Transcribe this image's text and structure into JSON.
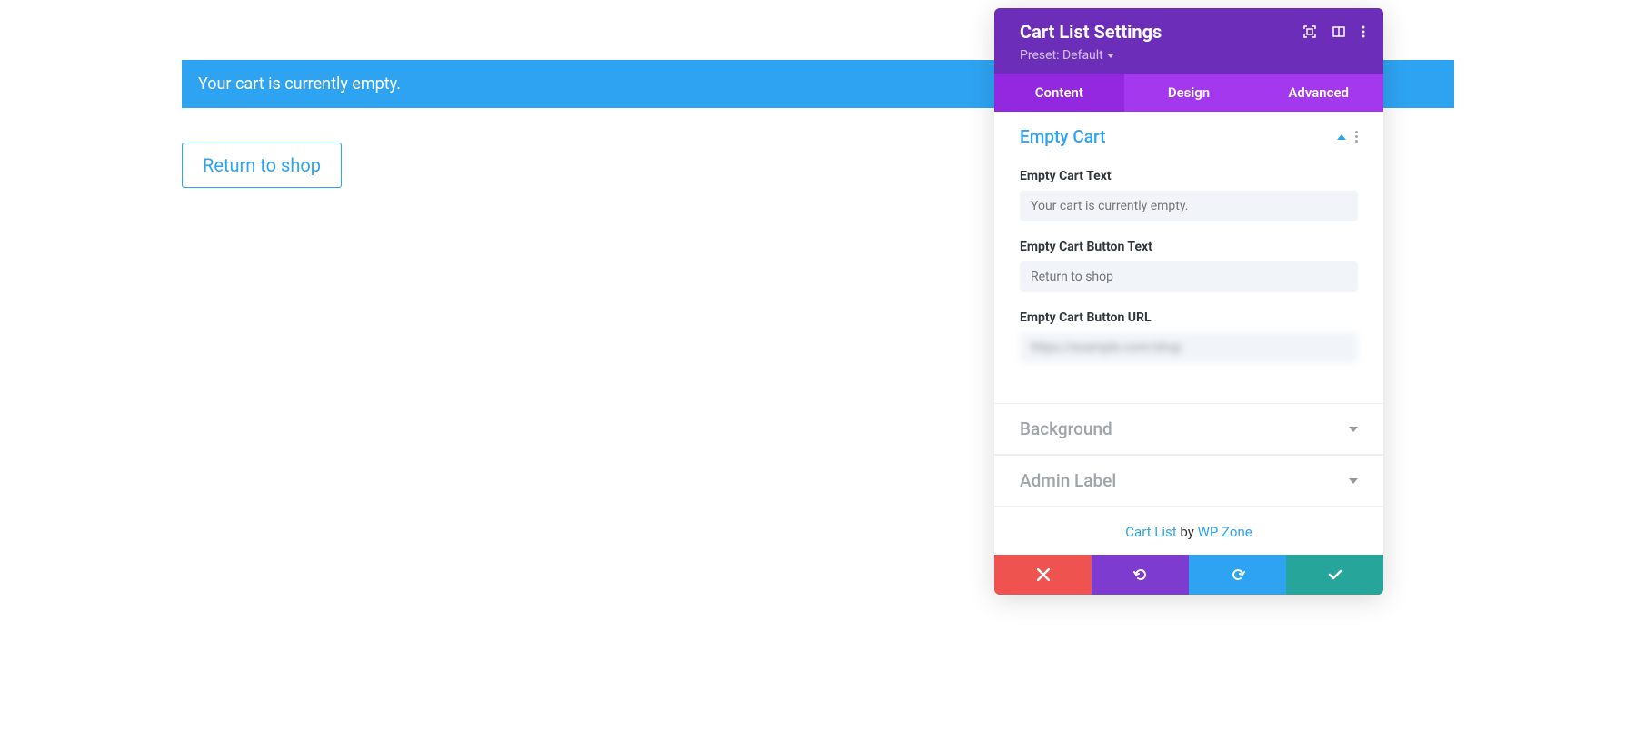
{
  "main": {
    "notice_text": "Your cart is currently empty.",
    "return_button_label": "Return to shop"
  },
  "panel": {
    "title": "Cart List Settings",
    "preset_label": "Preset: Default",
    "tabs": {
      "content": "Content",
      "design": "Design",
      "advanced": "Advanced"
    },
    "sections": {
      "empty_cart": {
        "title": "Empty Cart",
        "fields": {
          "text": {
            "label": "Empty Cart Text",
            "placeholder": "Your cart is currently empty."
          },
          "button_text": {
            "label": "Empty Cart Button Text",
            "placeholder": "Return to shop"
          },
          "button_url": {
            "label": "Empty Cart Button URL",
            "value": "https://example.com/shop"
          }
        }
      },
      "background": {
        "title": "Background"
      },
      "admin_label": {
        "title": "Admin Label"
      }
    },
    "footer": {
      "link_text": "Cart List",
      "by_text": " by ",
      "author_text": "WP Zone"
    }
  }
}
